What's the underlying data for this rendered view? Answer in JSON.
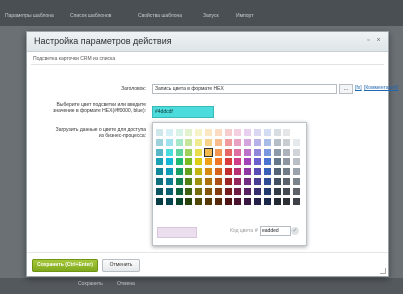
{
  "background": {
    "tabs": [
      "Параметры шаблона",
      "Список шаблонов",
      "Свойства шаблона",
      "Запуск",
      "Импорт"
    ],
    "bottom_buttons": [
      "Сохранить",
      "Отмена"
    ]
  },
  "dialog": {
    "title": "Настройка параметров действия",
    "subheading": "Подсветка карточки CRM из списка",
    "fields": {
      "title_label": "Заголовок:",
      "title_value": "Запись цвета в формате HEX",
      "dots_label": "...",
      "link_fx": "[fx]",
      "link_comments": "[Комментарий]",
      "color_label": "Выберите цвет подсветки или введите значение в формате HEX(#ff0000, blue):",
      "color_value": "#4ddcdf",
      "load_label": "Загрузить данные о цвете для доступа из бизнес-процесса:"
    },
    "picker": {
      "hex_label": "Код цвета",
      "hash": "#",
      "hex_value": "eadded",
      "preview_color": "#eaddeded",
      "ok_icon": "check-icon"
    },
    "save_label": "Сохранить (Ctrl+Enter)",
    "cancel_label": "Отменить"
  },
  "colors": {
    "accent_save": "#8db32a",
    "color_field": "#4ddcdc",
    "preview": "#eaddeded"
  },
  "palette": [
    [
      "#cfe6ea",
      "#d4f0f6",
      "#d6f3e6",
      "#e2f2cd",
      "#f5f3c7",
      "#fbe8c2",
      "#fbdcc2",
      "#f7cccc",
      "#f4cfe0",
      "#e8d1ee",
      "#d9d7f2",
      "#d2ddf3",
      "#d8dde2",
      "#e4e6e8",
      "#ffffff"
    ],
    [
      "#9bd2db",
      "#9fe1ef",
      "#a4e7c9",
      "#c6e59c",
      "#efe98f",
      "#f7d38a",
      "#f7bb8d",
      "#ef9b9b",
      "#e9a1c2",
      "#d4a4dd",
      "#b6b1e6",
      "#a7bde8",
      "#b5bec7",
      "#c8cdd2",
      "#e6e9eb"
    ],
    [
      "#57b7c7",
      "#4ddcdc",
      "#5ed39d",
      "#9fd15a",
      "#e8dc4c",
      "#f2b94d",
      "#f39652",
      "#e66666",
      "#de6ea2",
      "#bc71cb",
      "#8f87da",
      "#7897dc",
      "#8d9aa8",
      "#acb3ba",
      "#d0d4d8"
    ],
    [
      "#1aa0b4",
      "#14b7d6",
      "#1fba72",
      "#78bb23",
      "#dccc14",
      "#eea117",
      "#ee7624",
      "#d93a3a",
      "#d13c86",
      "#a343b9",
      "#6a5fce",
      "#4a73d0",
      "#65778a",
      "#8d96a0",
      "#b9bfc5"
    ],
    [
      "#12879a",
      "#0f9bb7",
      "#17a064",
      "#64a11a",
      "#c4b40f",
      "#d68b10",
      "#d6631b",
      "#c22d2d",
      "#b82f72",
      "#8d37a2",
      "#574cb6",
      "#3a5fb8",
      "#526375",
      "#727c87",
      "#9aa2ab"
    ],
    [
      "#0e6d7c",
      "#0b7c93",
      "#117f4f",
      "#508014",
      "#9c8f0b",
      "#ab6f0c",
      "#ab4f15",
      "#9b2424",
      "#93265b",
      "#712c82",
      "#463d92",
      "#2e4c93",
      "#41505e",
      "#5a636c",
      "#7b838b"
    ],
    [
      "#0a5460",
      "#085f71",
      "#0c613c",
      "#3c600f",
      "#756b08",
      "#805309",
      "#803b10",
      "#741b1b",
      "#6e1c44",
      "#552161",
      "#342e6e",
      "#22396e",
      "#313c47",
      "#434a51",
      "#5c6268"
    ],
    [
      "#073c45",
      "#064451",
      "#08452b",
      "#28400a",
      "#4e4705",
      "#553706",
      "#55270b",
      "#4d1212",
      "#49132d",
      "#381641",
      "#231f49",
      "#172649",
      "#21282f",
      "#2d3136",
      "#3d4145"
    ]
  ]
}
